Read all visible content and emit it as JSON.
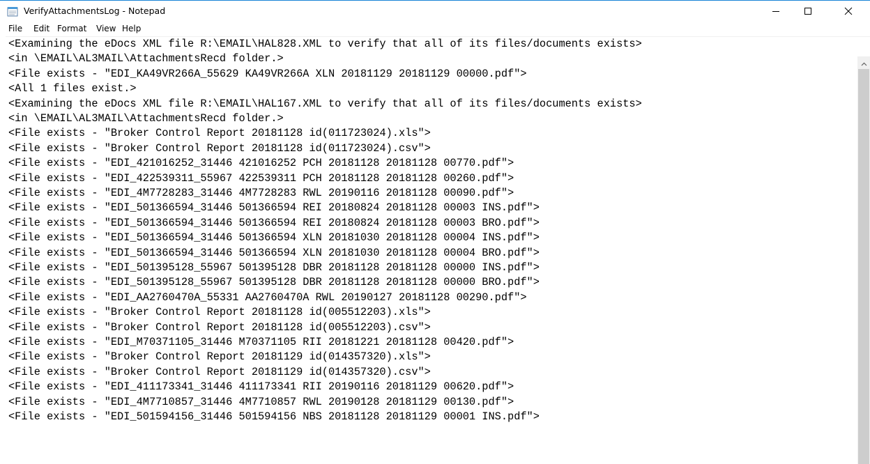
{
  "window": {
    "title": "VerifyAttachmentsLog - Notepad",
    "icon": "notepad-icon",
    "controls": [
      "minimize-icon",
      "maximize-icon",
      "close-icon"
    ]
  },
  "menu": {
    "file": "File",
    "edit": "Edit",
    "format": "Format",
    "view": "View",
    "help": "Help"
  },
  "editor": {
    "lines": [
      "<Examining the eDocs XML file R:\\EMAIL\\HAL828.XML to verify that all of its files/documents exists>",
      "<in \\EMAIL\\AL3MAIL\\AttachmentsRecd folder.>",
      "<File exists - \"EDI_KA49VR266A_55629 KA49VR266A XLN 20181129 20181129 00000.pdf\">",
      "<All 1 files exist.>",
      "<Examining the eDocs XML file R:\\EMAIL\\HAL167.XML to verify that all of its files/documents exists>",
      "<in \\EMAIL\\AL3MAIL\\AttachmentsRecd folder.>",
      "<File exists - \"Broker Control Report 20181128 id(011723024).xls\">",
      "<File exists - \"Broker Control Report 20181128 id(011723024).csv\">",
      "<File exists - \"EDI_421016252_31446 421016252 PCH 20181128 20181128 00770.pdf\">",
      "<File exists - \"EDI_422539311_55967 422539311 PCH 20181128 20181128 00260.pdf\">",
      "<File exists - \"EDI_4M7728283_31446 4M7728283 RWL 20190116 20181128 00090.pdf\">",
      "<File exists - \"EDI_501366594_31446 501366594 REI 20180824 20181128 00003 INS.pdf\">",
      "<File exists - \"EDI_501366594_31446 501366594 REI 20180824 20181128 00003 BRO.pdf\">",
      "<File exists - \"EDI_501366594_31446 501366594 XLN 20181030 20181128 00004 INS.pdf\">",
      "<File exists - \"EDI_501366594_31446 501366594 XLN 20181030 20181128 00004 BRO.pdf\">",
      "<File exists - \"EDI_501395128_55967 501395128 DBR 20181128 20181128 00000 INS.pdf\">",
      "<File exists - \"EDI_501395128_55967 501395128 DBR 20181128 20181128 00000 BRO.pdf\">",
      "<File exists - \"EDI_AA2760470A_55331 AA2760470A RWL 20190127 20181128 00290.pdf\">",
      "<File exists - \"Broker Control Report 20181128 id(005512203).xls\">",
      "<File exists - \"Broker Control Report 20181128 id(005512203).csv\">",
      "<File exists - \"EDI_M70371105_31446 M70371105 RII 20181221 20181128 00420.pdf\">",
      "<File exists - \"Broker Control Report 20181129 id(014357320).xls\">",
      "<File exists - \"Broker Control Report 20181129 id(014357320).csv\">",
      "<File exists - \"EDI_411173341_31446 411173341 RII 20190116 20181129 00620.pdf\">",
      "<File exists - \"EDI_4M7710857_31446 4M7710857 RWL 20190128 20181129 00130.pdf\">",
      "<File exists - \"EDI_501594156_31446 501594156 NBS 20181128 20181129 00001 INS.pdf\">"
    ]
  },
  "scrollbar": {
    "up_icon": "scroll-up-arrow-icon"
  }
}
